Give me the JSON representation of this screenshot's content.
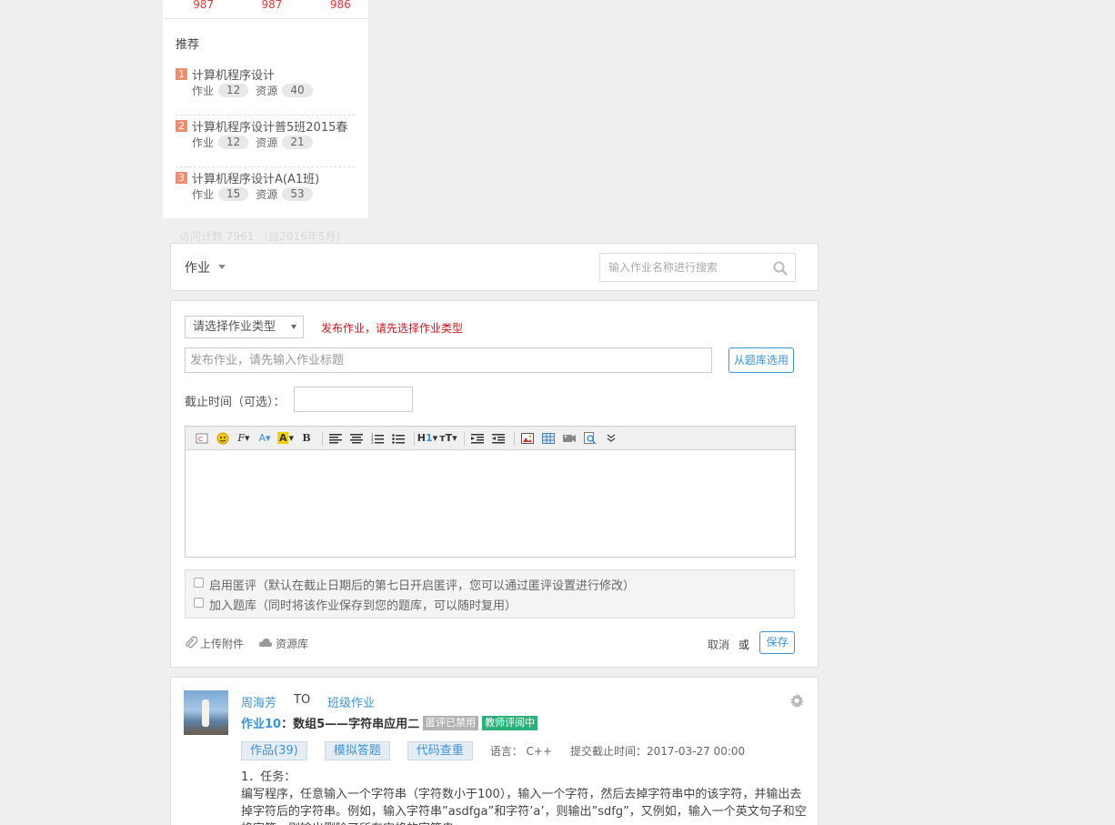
{
  "sidebar": {
    "stats": [
      "987",
      "987",
      "986"
    ],
    "recommend_title": "推荐",
    "items": [
      {
        "rank": "1",
        "name": "计算机程序设计",
        "hw_label": "作业",
        "hw_count": "12",
        "res_label": "资源",
        "res_count": "40"
      },
      {
        "rank": "2",
        "name": "计算机程序设计普5班2015春",
        "hw_label": "作业",
        "hw_count": "12",
        "res_label": "资源",
        "res_count": "21"
      },
      {
        "rank": "3",
        "name": "计算机程序设计A(A1班)",
        "hw_label": "作业",
        "hw_count": "15",
        "res_label": "资源",
        "res_count": "53"
      }
    ],
    "visit_count": "访问计数 7961 （自2016年5月）"
  },
  "header": {
    "title": "作业",
    "search_placeholder": "输入作业名称进行搜索"
  },
  "publish": {
    "type_select": "请选择作业类型",
    "hint": "发布作业，请先选择作业类型",
    "title_placeholder": "发布作业，请先输入作业标题",
    "bank_button": "从题库选用",
    "deadline_label": "截止时间（可选）：",
    "option_anonymous": "启用匿评（默认在截止日期后的第七日开启匿评，您可以通过匿评设置进行修改）",
    "option_bank": "加入题库（同时将该作业保存到您的题库，可以随时复用）",
    "upload_label": "上传附件",
    "reslib_label": "资源库",
    "cancel_label": "取消",
    "or_label": "或",
    "save_label": "保存"
  },
  "homework": {
    "author": "周海芳",
    "to": "TO",
    "class": "班级作业",
    "number": "作业10",
    "colon": "：",
    "title": "数组5——字符串应用二",
    "badge_disabled": "匿评已禁用",
    "badge_reviewing": "教师评阅中",
    "tab_works": "作品(39)",
    "tab_simulate": "模拟答题",
    "tab_code": "代码查重",
    "language": "语言： C++",
    "deadline": "提交截止时间：2017-03-27 00:00",
    "desc_line1": "1．任务：",
    "desc_line2": "编写程序，任意输入一个字符串（字符数小于100），输入一个字符，然后去掉字符串中的该字符，并输出去掉字符后的字符串。例如，输入字符串”asdfga”和字符’a’，则输出”sdfg”，又例如，输入一个英文句子和空格字符，则输出删除了所有空格的字符串。"
  },
  "colors": {
    "accent": "#3b94d9",
    "stat_red": "#e23838",
    "rank_orange": "#f08d6e",
    "hint_red": "#d2151c",
    "badge_gray": "#b2b2b2",
    "badge_green": "#2ab27b"
  }
}
